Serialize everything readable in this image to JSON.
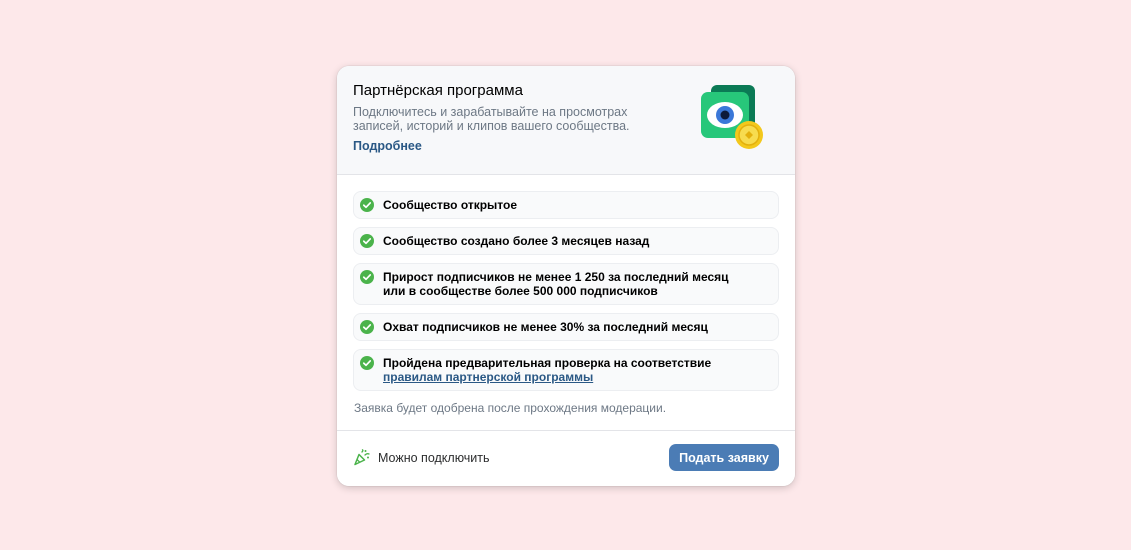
{
  "header": {
    "title": "Партнёрская программа",
    "description": "Подключитесь и зарабатывайте на просмотрах записей, историй и клипов вашего сообщества.",
    "more_link": "Подробнее"
  },
  "requirements": [
    {
      "text": "Сообщество открытое"
    },
    {
      "text": "Сообщество создано более 3 месяцев назад"
    },
    {
      "line1": "Прирост подписчиков не менее 1 250 за последний месяц",
      "line2": "или в сообществе более 500 000 подписчиков"
    },
    {
      "text": "Охват подписчиков не менее 30% за последний месяц"
    },
    {
      "text": "Пройдена предварительная проверка на соответствие ",
      "link": "правилам партнерской программы"
    }
  ],
  "note": "Заявка будет одобрена после прохождения модерации.",
  "footer": {
    "status_label": "Можно подключить",
    "submit_label": "Подать заявку"
  },
  "colors": {
    "background": "#fde8ea",
    "check": "#4bb34b",
    "link": "#2a5885",
    "button": "#4b7cb5"
  }
}
